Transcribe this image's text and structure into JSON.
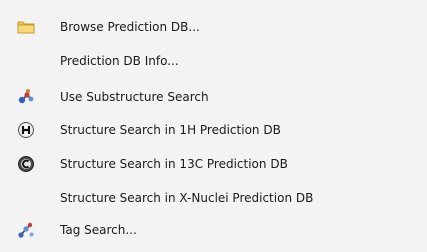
{
  "menu": {
    "items": [
      {
        "label": "Browse Prediction DB...",
        "icon": "folder-icon"
      },
      {
        "label": "Prediction DB Info...",
        "icon": ""
      },
      {
        "label": "Use Substructure Search",
        "icon": "substructure-molecule-icon"
      },
      {
        "label": "Structure Search in 1H Prediction DB",
        "icon": "h-nucleus-icon"
      },
      {
        "label": "Structure Search in 13C Prediction DB",
        "icon": "c-nucleus-icon"
      },
      {
        "label": "Structure Search in X-Nuclei Prediction DB",
        "icon": ""
      },
      {
        "label": "Tag Search...",
        "icon": "tag-search-icon"
      }
    ]
  }
}
